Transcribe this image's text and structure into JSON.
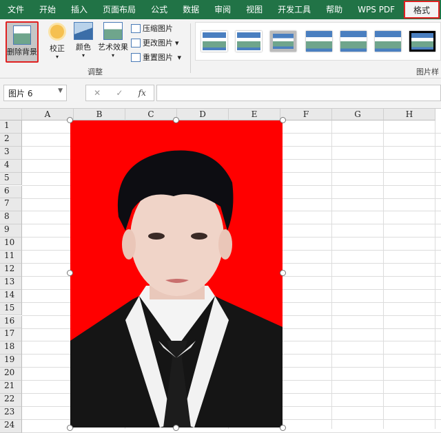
{
  "tabs": [
    "文件",
    "开始",
    "插入",
    "页面布局",
    "公式",
    "数据",
    "审阅",
    "视图",
    "开发工具",
    "帮助",
    "WPS PDF"
  ],
  "active_tab": "格式",
  "ribbon": {
    "remove_bg": "删除背景",
    "correct": "校正",
    "color": "颜色",
    "art": "艺术效果",
    "compress": "压缩图片",
    "change": "更改图片",
    "reset": "重置图片",
    "adjust_group": "调整",
    "styles_group": "图片样式"
  },
  "namebox": "图片 6",
  "fx": "fx",
  "columns": [
    "A",
    "B",
    "C",
    "D",
    "E",
    "F",
    "G",
    "H"
  ],
  "rows": [
    "1",
    "2",
    "3",
    "4",
    "5",
    "6",
    "7",
    "8",
    "9",
    "10",
    "11",
    "12",
    "13",
    "14",
    "15",
    "16",
    "17",
    "18",
    "19",
    "20",
    "21",
    "22",
    "23",
    "24"
  ],
  "colors": {
    "accent": "#217346",
    "photo_bg": "#ff0000",
    "highlight": "#e02020"
  }
}
